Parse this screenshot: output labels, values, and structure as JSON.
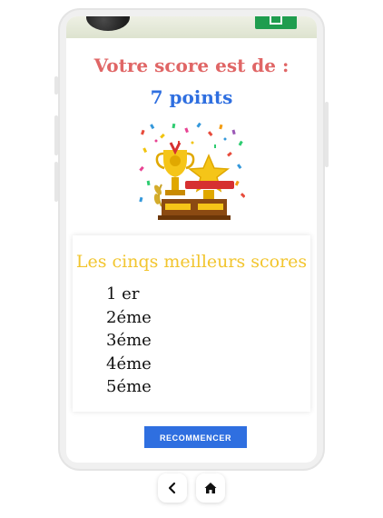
{
  "score": {
    "title": "Votre score est de :",
    "value": "7 points"
  },
  "trophy": {
    "icon": "trophy-celebration-icon"
  },
  "leaderboard": {
    "title": "Les cinqs meilleurs scores",
    "ranks": [
      "1 er",
      "2éme",
      "3éme",
      "4éme",
      "5éme"
    ]
  },
  "actions": {
    "restart_label": "RECOMMENCER"
  },
  "nav": {
    "back_icon": "chevron-left-icon",
    "home_icon": "home-icon"
  },
  "colors": {
    "score_title": "#e06666",
    "score_value": "#2f6fe0",
    "leaderboard_title": "#f2c52e",
    "button": "#2f6fe0"
  }
}
